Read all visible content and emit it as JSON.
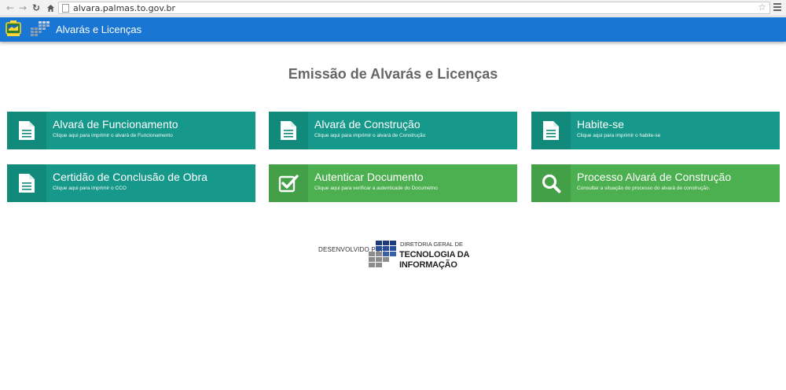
{
  "browser": {
    "url": "alvara.palmas.to.gov.br",
    "back_icon": "arrow-left-icon",
    "forward_icon": "arrow-right-icon",
    "reload_icon": "reload-icon",
    "home_icon": "home-icon",
    "bookmark_icon": "star-icon",
    "menu_icon": "hamburger-menu-icon"
  },
  "appbar": {
    "title": "Alvarás e Licenças",
    "color": "#1976d2"
  },
  "main": {
    "title": "Emissão de Alvarás e Licenças",
    "cards": [
      {
        "title": "Alvará de Funcionamento",
        "subtitle": "Clique aqui para imprimir o alvará de Funcionamento",
        "icon": "document-icon",
        "color": "#16998a"
      },
      {
        "title": "Alvará de Construção",
        "subtitle": "Clique aqui para imprimir o alvará de Construção",
        "icon": "document-icon",
        "color": "#16998a"
      },
      {
        "title": "Habite-se",
        "subtitle": "Clique aqui para imprimir o habite-se",
        "icon": "document-icon",
        "color": "#16998a"
      },
      {
        "title": "Certidão de Conclusão de Obra",
        "subtitle": "Clique aqui para imprimir o CCO",
        "icon": "document-icon",
        "color": "#16998a"
      },
      {
        "title": "Autenticar Documento",
        "subtitle": "Clique aqui para verificar a autenticade do Documetno",
        "icon": "checkbox-icon",
        "color": "#4caf50"
      },
      {
        "title": "Processo Alvará de Construção",
        "subtitle": "Consultar a situação do processo do alvará de construção.",
        "icon": "search-icon",
        "color": "#4caf50"
      }
    ]
  },
  "footer": {
    "developed_by": "DESENVOLVIDO POR",
    "org_line1": "DIRETORIA GERAL DE",
    "org_line2": "TECNOLOGIA DA",
    "org_line3": "INFORMAÇÃO"
  }
}
